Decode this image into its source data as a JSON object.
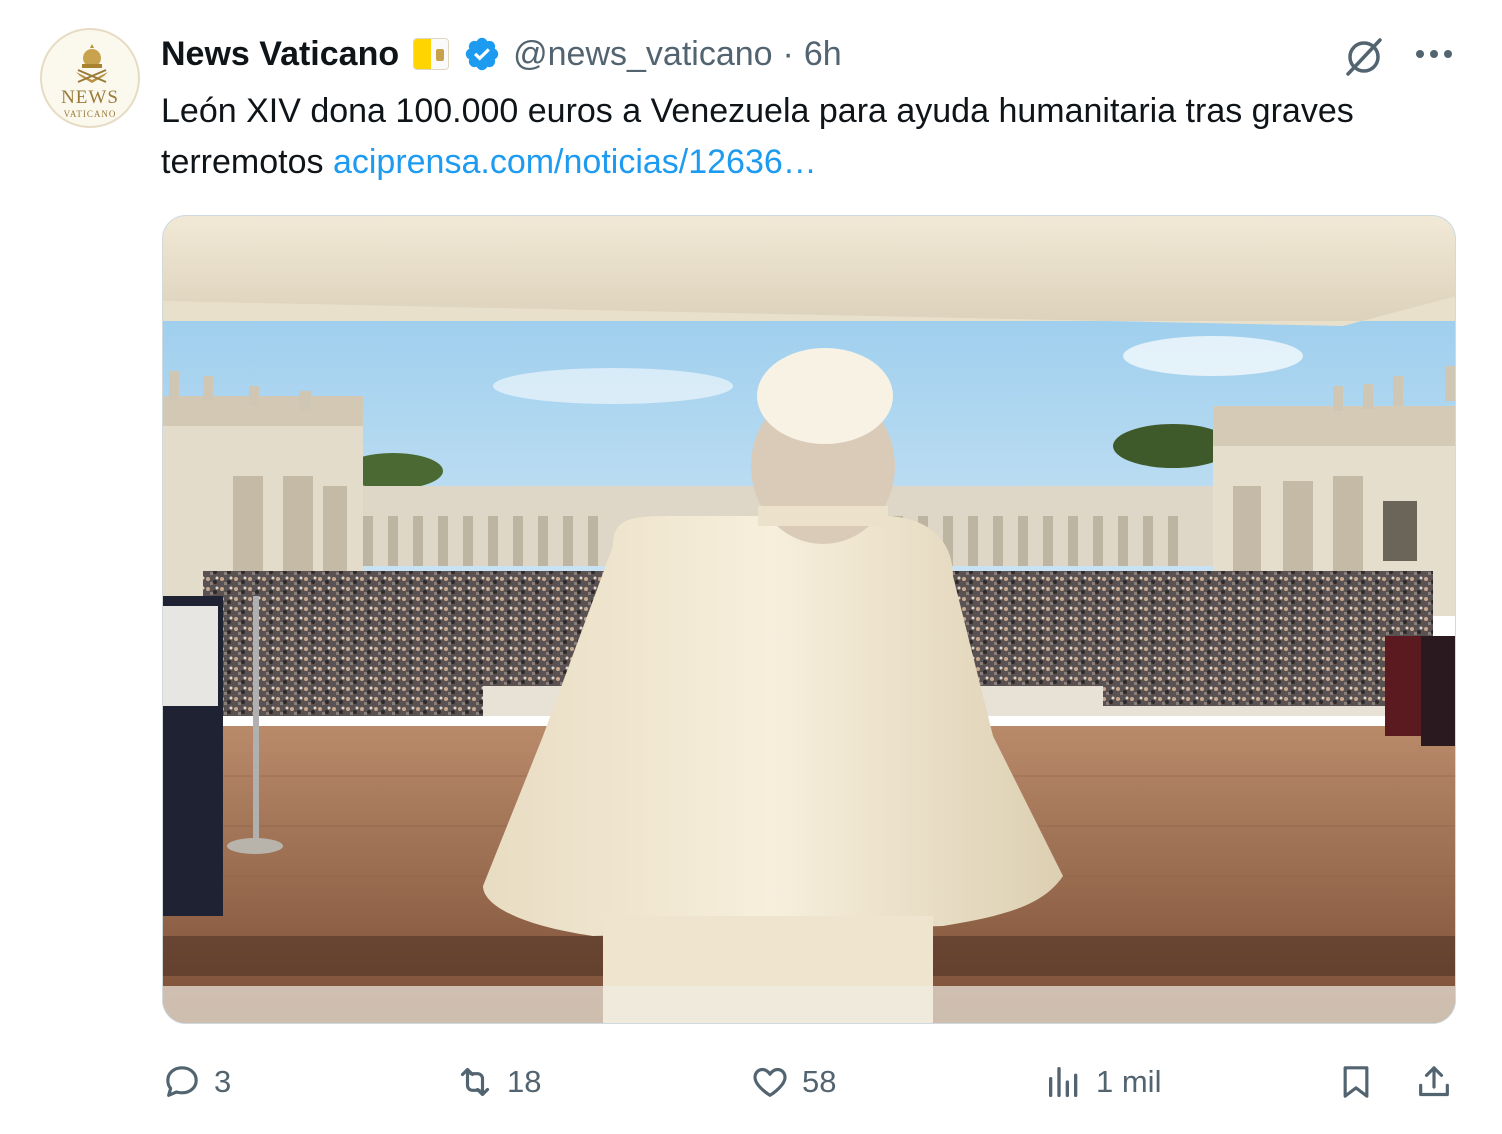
{
  "author": {
    "display_name": "News Vaticano",
    "handle": "@news_vaticano",
    "separator": "·",
    "time": "6h",
    "avatar_text": "NEWS",
    "avatar_subtext": "VATICANO",
    "flag_icon": "vatican-flag-icon",
    "verified_icon": "verified-badge-icon",
    "verified_color": "#1d9bf0"
  },
  "header_actions": {
    "grok_icon": "grok-icon",
    "more_icon": "more-icon"
  },
  "tweet": {
    "text": "León XIV dona 100.000 euros a Venezuela para ayuda humanitaria tras graves terremotos ",
    "link": "aciprensa.com/noticias/12636…",
    "link_color": "#1d9bf0"
  },
  "media": {
    "type": "photo",
    "subject_icon": "photo-image"
  },
  "actions": {
    "reply": {
      "icon": "reply-icon",
      "count": "3"
    },
    "retweet": {
      "icon": "retweet-icon",
      "count": "18"
    },
    "like": {
      "icon": "heart-icon",
      "count": "58"
    },
    "views": {
      "icon": "views-icon",
      "count": "1 mil"
    },
    "bookmark": {
      "icon": "bookmark-icon"
    },
    "share": {
      "icon": "share-icon"
    }
  },
  "colors": {
    "text_primary": "#0f1419",
    "text_secondary": "#536471",
    "accent": "#1d9bf0"
  }
}
